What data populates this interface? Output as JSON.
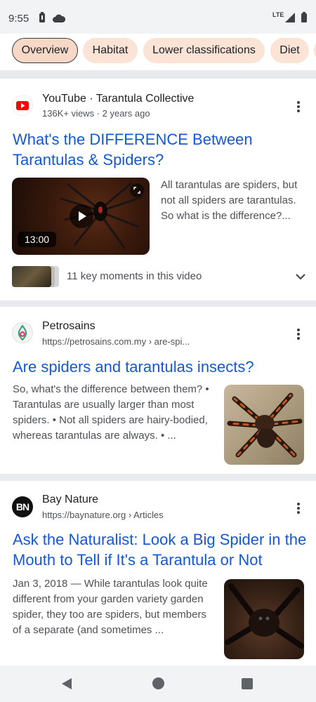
{
  "status": {
    "time": "9:55",
    "network": "LTE"
  },
  "chips": [
    "Overview",
    "Habitat",
    "Lower classifications",
    "Diet"
  ],
  "results": [
    {
      "source": "YouTube · Tarantula Collective",
      "meta": "136K+ views · 2 years ago",
      "title_line1": "What's the DIFFERENCE Between",
      "title_line2": "Tarantulas & Spiders?",
      "snippet_line1": "All tarantulas are spiders, but",
      "snippet_line2": "not all spiders are tarantulas.",
      "snippet_line3": "So what is the difference?...",
      "duration": "13:00",
      "key_moments": "11 key moments in this video"
    },
    {
      "source": "Petrosains",
      "meta": "https://petrosains.com.my › are-spi...",
      "title": "Are spiders and tarantulas insects?",
      "snippet_line1": "So, what's the difference between them? •",
      "snippet_line2": "Tarantulas are usually larger than most",
      "snippet_line3": "spiders. • Not all spiders are hairy-bodied,",
      "snippet_line4": "whereas tarantulas are always. • ..."
    },
    {
      "source": "Bay Nature",
      "meta": "https://baynature.org › Articles",
      "logo_text": "BN",
      "title_line1": "Ask the Naturalist: Look a Big Spider in the",
      "title_line2": "Mouth to Tell if It's a Tarantula or Not",
      "snippet_line1": "Jan 3, 2018 — While tarantulas look quite",
      "snippet_line2": "different from your garden variety garden",
      "snippet_line3": "spider, they too are spiders, but members",
      "snippet_line4": "of a separate (and sometimes ..."
    }
  ],
  "colors": {
    "link": "#1558d6",
    "chip": "#fbe3d6",
    "youtube": "#ff0000"
  }
}
